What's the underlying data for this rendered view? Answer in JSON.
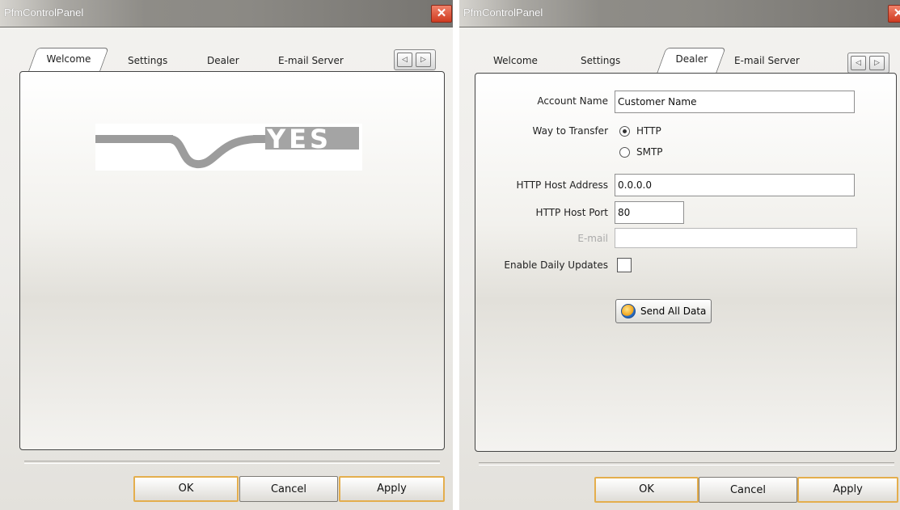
{
  "window1": {
    "title": "PfmControlPanel",
    "tabs": [
      "Welcome",
      "Settings",
      "Dealer",
      "E-mail Server"
    ],
    "active_tab": "Welcome",
    "logo_text": "YES",
    "buttons": {
      "ok": "OK",
      "cancel": "Cancel",
      "apply": "Apply"
    }
  },
  "window2": {
    "title": "PfmControlPanel",
    "tabs": [
      "Welcome",
      "Settings",
      "Dealer",
      "E-mail Server"
    ],
    "active_tab": "Dealer",
    "form": {
      "account_name_label": "Account Name",
      "account_name_value": "Customer Name",
      "way_label": "Way to Transfer",
      "way_options": [
        "HTTP",
        "SMTP"
      ],
      "way_selected": "HTTP",
      "host_label": "HTTP Host Address",
      "host_value": "0.0.0.0",
      "port_label": "HTTP Host Port",
      "port_value": "80",
      "email_label": "E-mail",
      "email_value": "",
      "daily_label": "Enable Daily Updates",
      "daily_checked": false,
      "send_label": "Send All Data"
    },
    "buttons": {
      "ok": "OK",
      "cancel": "Cancel",
      "apply": "Apply"
    }
  },
  "icons": {
    "close": "close-icon",
    "prev": "arrow-left-icon",
    "next": "arrow-right-icon",
    "send": "globe-icon"
  },
  "colors": {
    "close_button": "#d9472b",
    "default_button_border": "#e4ae4d"
  }
}
